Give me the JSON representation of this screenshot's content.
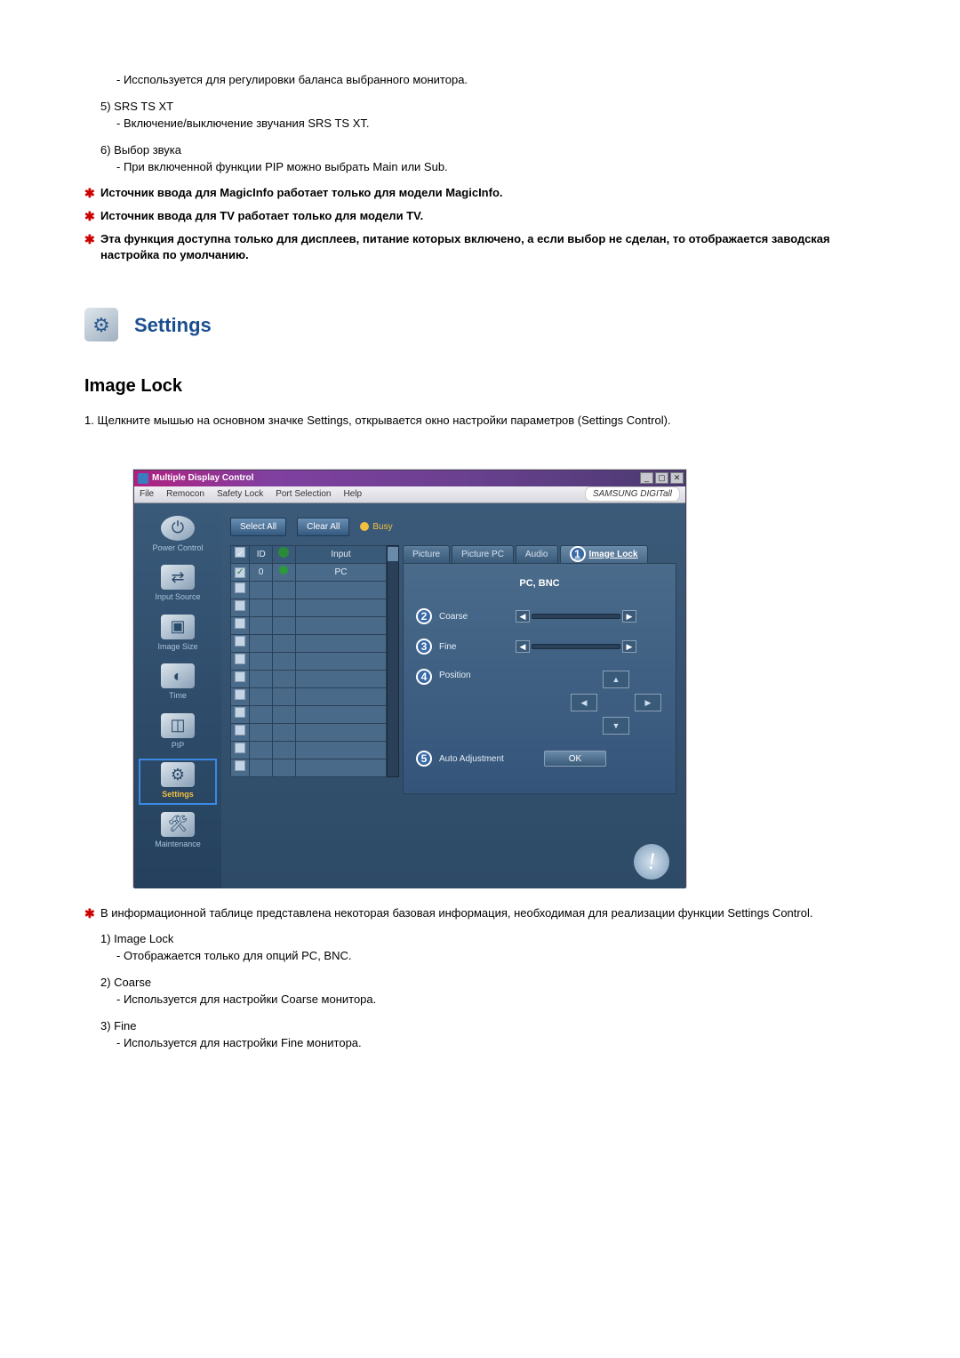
{
  "prelude": {
    "item4_desc": "- Исспользуется для регулировки баланса выбранного монитора.",
    "item5_num": "5)  SRS TS XT",
    "item5_desc": "- Включение/выключение звучания SRS TS XT.",
    "item6_num": "6)  Выбор звука",
    "item6_desc": "- При включенной функции PIP можно выбрать Main или Sub.",
    "note1": "Источник ввода для MagicInfo работает только для модели MagicInfo.",
    "note2": "Источник ввода для TV работает только для модели TV.",
    "note3": "Эта функция доступна только для дисплеев, питание которых включено, а если выбор не сделан, то отображается заводская настройка по умолчанию."
  },
  "section": {
    "title": "Settings",
    "subheading": "Image Lock",
    "step1": "1.  Щелкните мышью на основном значке Settings, открывается окно настройки параметров (Settings Control)."
  },
  "app": {
    "window_title": "Multiple Display Control",
    "menus": {
      "file": "File",
      "remocon": "Remocon",
      "safety": "Safety Lock",
      "port": "Port Selection",
      "help": "Help"
    },
    "brand": "SAMSUNG DIGITall",
    "sidebar": {
      "power": "Power Control",
      "input": "Input Source",
      "size": "Image Size",
      "time": "Time",
      "pip": "PIP",
      "settings": "Settings",
      "maint": "Maintenance"
    },
    "actions": {
      "select_all": "Select All",
      "clear_all": "Clear All",
      "busy": "Busy"
    },
    "table": {
      "chk_hdr": "✓",
      "id_hdr": "ID",
      "stat_hdr": "",
      "input_hdr": "Input",
      "row0": {
        "id": "0",
        "input": "PC"
      }
    },
    "tabs": {
      "picture": "Picture",
      "picture_pc": "Picture PC",
      "audio": "Audio",
      "image_lock": "Image Lock"
    },
    "panel": {
      "mode": "PC, BNC",
      "coarse": "Coarse",
      "fine": "Fine",
      "position": "Position",
      "auto": "Auto Adjustment",
      "ok": "OK"
    }
  },
  "post": {
    "note": "В информационной таблице представлена некоторая базовая информация, необходимая для реализации функции Settings Control.",
    "item1_num": "1)  Image Lock",
    "item1_desc": "- Отображается только для опций PC, BNC.",
    "item2_num": "2)  Coarse",
    "item2_desc": "- Используется для настройки Coarse монитора.",
    "item3_num": "3)  Fine",
    "item3_desc": "- Используется для настройки Fine монитора."
  }
}
